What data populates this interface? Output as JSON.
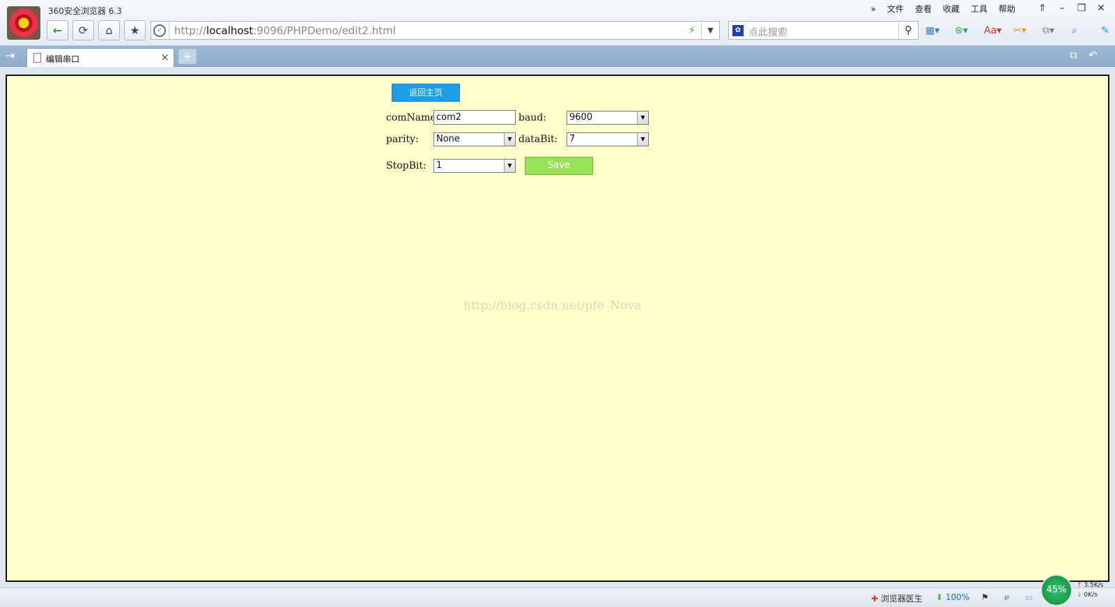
{
  "browser": {
    "app_title": "360安全浏览器 6.3",
    "menus": [
      "»",
      "文件",
      "查看",
      "收藏",
      "工具",
      "帮助"
    ],
    "url_prefix": "http://",
    "url_host": "localhost",
    "url_rest": ":9096/PHPDemo/edit2.html",
    "search_placeholder": "点此搜索"
  },
  "tab": {
    "label": "编辑串口"
  },
  "form": {
    "home_button": "返回主页",
    "comname_label": "comName:",
    "comname_value": "com2",
    "baud_label": "baud:",
    "baud_value": "9600",
    "parity_label": "parity:",
    "parity_value": "None",
    "databit_label": "dataBit:",
    "databit_value": "7",
    "stopbit_label": "StopBit:",
    "stopbit_value": "1",
    "save_button": "Save"
  },
  "watermark": "http://blog.csdn.net/pfe_Nova",
  "statusbar": {
    "doctor": "浏览器医生",
    "zoom": "100%",
    "gauge": "45%",
    "upload": "3.5K/s",
    "download": "0K/s"
  }
}
